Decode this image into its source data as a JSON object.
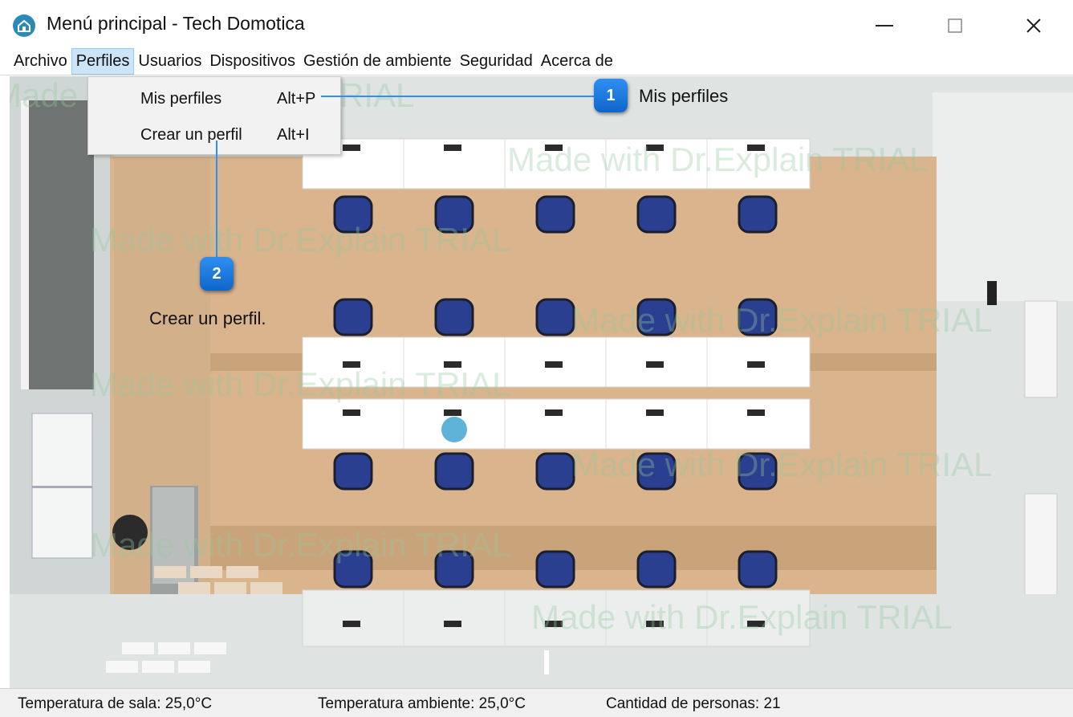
{
  "window": {
    "title": "Menú principal - Tech Domotica",
    "minimize_glyph": "—",
    "maximize_glyph": "☐",
    "close_glyph": "✕",
    "icon": "home-icon"
  },
  "menubar": {
    "items": [
      {
        "label": "Archivo"
      },
      {
        "label": "Perfiles",
        "active": true
      },
      {
        "label": "Usuarios"
      },
      {
        "label": "Dispositivos"
      },
      {
        "label": "Gestión de ambiente"
      },
      {
        "label": "Seguridad"
      },
      {
        "label": "Acerca de"
      }
    ]
  },
  "perfiles_menu": {
    "items": [
      {
        "label": "Mis perfiles",
        "shortcut": "Alt+P"
      },
      {
        "label": "Crear un perfil",
        "shortcut": "Alt+I"
      }
    ]
  },
  "callouts": [
    {
      "number": "1",
      "text": "Mis perfiles"
    },
    {
      "number": "2",
      "text": "Crear un perfil."
    }
  ],
  "watermark": {
    "text": "Made with Dr.Explain TRIAL"
  },
  "statusbar": {
    "room_temperature": "Temperatura de sala: 25,0°C",
    "ambient_temperature": "Temperatura ambiente: 25,0°C",
    "people_count": "Cantidad de personas: 21"
  },
  "colors": {
    "callout_blue": "#1a78e0",
    "menu_highlight": "#cce4f7",
    "floor_wood": "#d9b48c",
    "chair_blue": "#2a3f8f"
  }
}
